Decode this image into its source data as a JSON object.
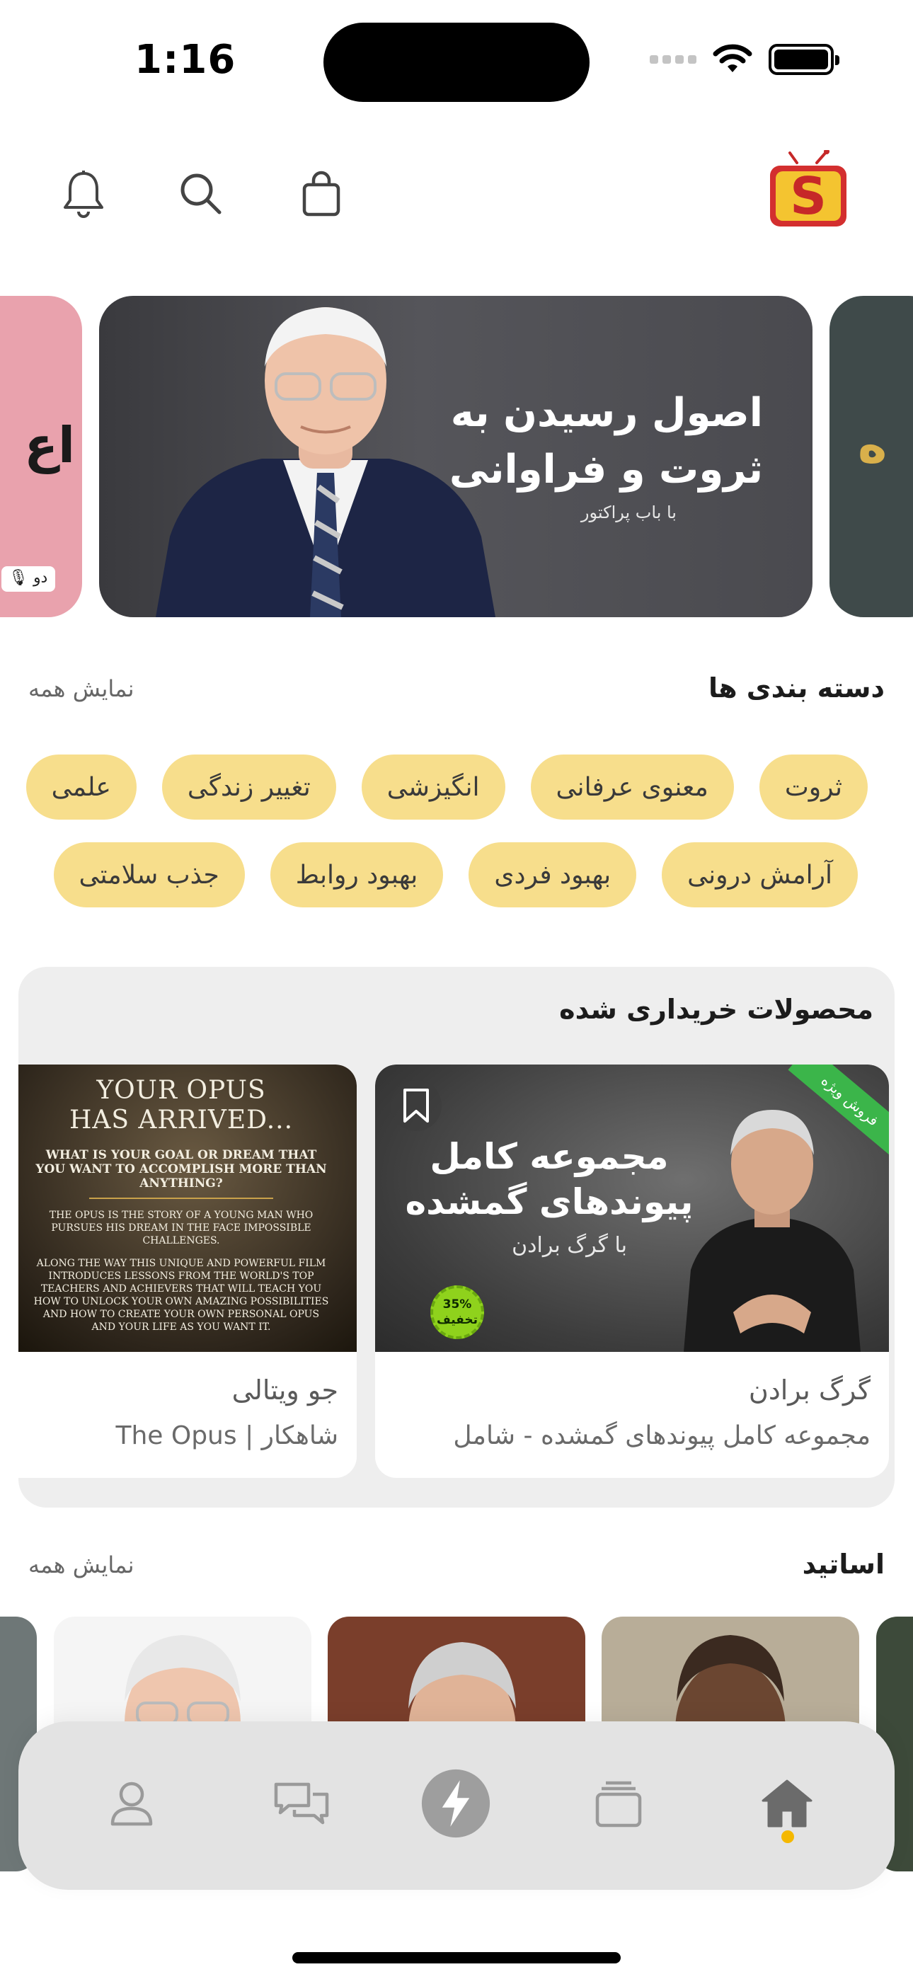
{
  "status_bar": {
    "time": "1:16"
  },
  "header": {
    "icons": [
      "bell-icon",
      "search-icon",
      "shopping-bag-icon"
    ],
    "logo_letter": "S"
  },
  "banners": {
    "left_partial": {
      "text": "اع",
      "pill": "دو"
    },
    "main": {
      "title_line1": "اصول رسیدن به",
      "title_line2": "ثروت و فراوانی",
      "subtitle": "با باب پراکتور"
    },
    "right_partial": {
      "text": "ه"
    }
  },
  "categories": {
    "title": "دسته بندی ها",
    "show_all": "نمایش همه",
    "row1": [
      "ثروت",
      "معنوی عرفانی",
      "انگیزشی",
      "تغییر زندگی",
      "علمی"
    ],
    "row2": [
      "آرامش درونی",
      "بهبود فردی",
      "بهبود روابط",
      "جذب سلامتی"
    ]
  },
  "purchased": {
    "title": "محصولات خریداری شده",
    "cards": [
      {
        "image_title_line1": "مجموعه کامل",
        "image_title_line2": "پیوندهای گمشده",
        "image_subtitle": "با گرگ برادن",
        "ribbon": "فروش ویژه",
        "discount_percent": "35%",
        "discount_label": "تخفیف",
        "author": "گرگ برادن",
        "name": "مجموعه کامل پیوندهای گمشده - شامل"
      },
      {
        "image_heading_line1": "YOUR OPUS",
        "image_heading_line2": "HAS ARRIVED...",
        "image_question": "WHAT IS YOUR GOAL OR DREAM THAT YOU WANT TO ACCOMPLISH MORE THAN ANYTHING?",
        "image_para1": "THE OPUS IS THE STORY OF A YOUNG MAN WHO PURSUES HIS DREAM IN THE FACE IMPOSSIBLE CHALLENGES.",
        "image_para2": "ALONG THE WAY THIS UNIQUE AND POWERFUL FILM INTRODUCES LESSONS FROM THE WORLD'S TOP TEACHERS AND ACHIEVERS THAT WILL TEACH YOU HOW TO UNLOCK YOUR OWN AMAZING POSSIBILITIES AND HOW TO CREATE YOUR OWN PERSONAL OPUS AND YOUR LIFE AS YOU WANT IT.",
        "author": "جو ویتالی",
        "name": "شاهکار | The Opus"
      }
    ]
  },
  "masters": {
    "title": "اساتید",
    "show_all": "نمایش همه"
  },
  "tabbar": {
    "tabs": [
      "profile-icon",
      "chat-icon",
      "lightning-icon",
      "library-icon",
      "home-icon"
    ],
    "active": "home-icon",
    "accent": "#f5b800"
  },
  "colors": {
    "chip_bg": "#f7de8c",
    "ribbon": "#3bb54a",
    "discount": "#8fd21c"
  }
}
